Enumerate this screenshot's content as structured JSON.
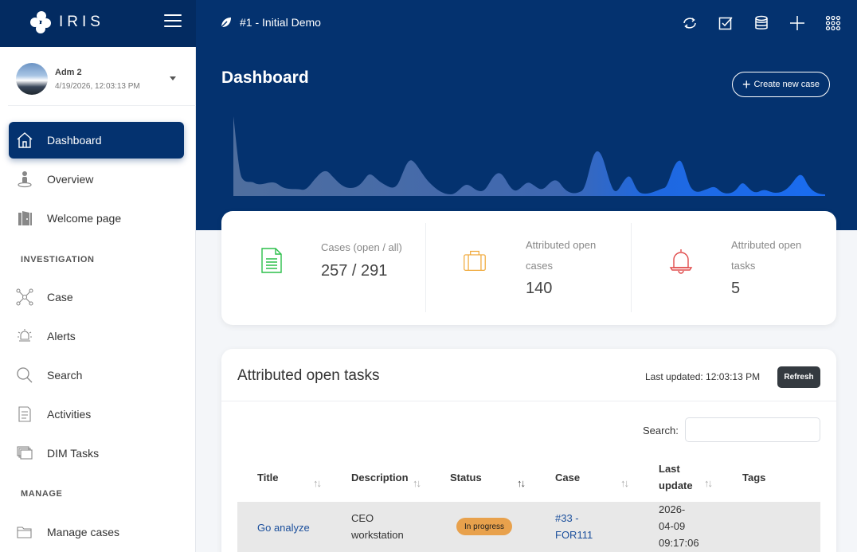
{
  "app": {
    "brand": "IRIS",
    "case_title": "#1 - Initial Demo"
  },
  "topbar": {
    "icons": [
      "refresh-icon",
      "checkbox-icon",
      "database-icon",
      "plus-icon",
      "apps-grid-icon"
    ]
  },
  "user": {
    "name": "Adm 2",
    "datetime": "4/19/2026, 12:03:13 PM"
  },
  "sidebar": {
    "items": [
      {
        "label": "Dashboard",
        "icon": "home-icon",
        "active": true
      },
      {
        "label": "Overview",
        "icon": "person-pin-icon"
      },
      {
        "label": "Welcome page",
        "icon": "door-icon"
      }
    ],
    "investigation_title": "INVESTIGATION",
    "investigation": [
      {
        "label": "Case",
        "icon": "network-icon"
      },
      {
        "label": "Alerts",
        "icon": "alert-icon"
      },
      {
        "label": "Search",
        "icon": "search-icon"
      },
      {
        "label": "Activities",
        "icon": "list-icon"
      },
      {
        "label": "DIM Tasks",
        "icon": "stack-icon"
      }
    ],
    "manage_title": "MANAGE",
    "manage": [
      {
        "label": "Manage cases",
        "icon": "folder-icon"
      }
    ]
  },
  "header": {
    "title": "Dashboard",
    "create_button": "Create new case"
  },
  "stats": {
    "cases": {
      "label": "Cases (open / all)",
      "value": "257 / 291",
      "color": "#2bbf4a"
    },
    "attributed_cases": {
      "label_line1": "Attributed open",
      "label_line2": "cases",
      "value": "140",
      "color": "#f0a93a"
    },
    "attributed_tasks": {
      "label_line1": "Attributed open",
      "label_line2": "tasks",
      "value": "5",
      "color": "#e04a4a"
    }
  },
  "tasks": {
    "title": "Attributed open tasks",
    "last_updated": "Last updated: 12:03:13 PM",
    "refresh": "Refresh",
    "search_label": "Search:",
    "search_value": "",
    "columns": {
      "title": "Title",
      "description": "Description",
      "status": "Status",
      "case": "Case",
      "last_update_1": "Last",
      "last_update_2": "update",
      "tags": "Tags"
    },
    "rows": [
      {
        "title": "Go analyze",
        "description_1": "CEO",
        "description_2": "workstation",
        "status": "In progress",
        "case_1": "#33 -",
        "case_2": "FOR111",
        "updated_1": "2026-",
        "updated_2": "04-09",
        "updated_3": "09:17:06",
        "tags": ""
      }
    ]
  },
  "colors": {
    "primary": "#04326f",
    "spark_light": "#4f7cc0",
    "spark_bright": "#1e6ae6"
  }
}
